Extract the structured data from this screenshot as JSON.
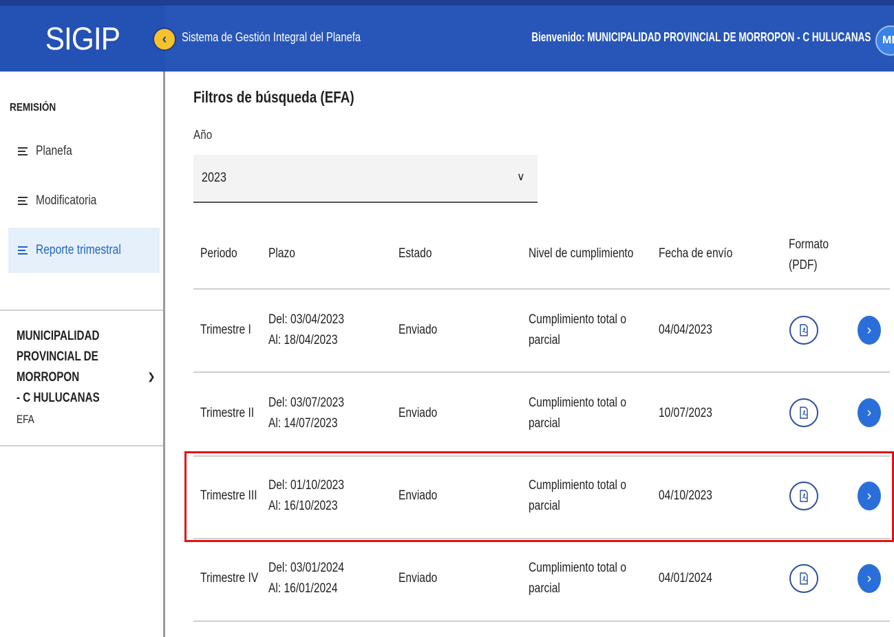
{
  "header": {
    "logo": "SIGIP",
    "app_name": "Sistema de Gestión Integral del Planefa",
    "welcome": "Bienvenido: MUNICIPALIDAD PROVINCIAL DE MORROPON - C HULUCANAS",
    "avatar_initials": "MP",
    "collapse_icon": "chevron-left-icon"
  },
  "sidebar": {
    "section_title": "REMISIÓN",
    "items": [
      {
        "label": "Planefa",
        "active": false
      },
      {
        "label": "Modificatoria",
        "active": false
      },
      {
        "label": "Reporte trimestral",
        "active": true
      }
    ],
    "entity": "MUNICIPALIDAD\nPROVINCIAL DE MORROPON\n- C HULUCANAS",
    "entity_type": "EFA"
  },
  "filters": {
    "title": "Filtros de búsqueda (EFA)",
    "year_label": "Año",
    "year_value": "2023"
  },
  "table": {
    "headers": {
      "periodo": "Periodo",
      "plazo": "Plazo",
      "estado": "Estado",
      "nivel": "Nivel de cumplimiento",
      "fecha": "Fecha de envío",
      "formato_1": "Formato",
      "formato_2": "(PDF)"
    },
    "rows": [
      {
        "periodo": "Trimestre I",
        "del": "Del: 03/04/2023",
        "al": "Al: 18/04/2023",
        "estado": "Enviado",
        "nivel_1": "Cumplimiento total o",
        "nivel_2": "parcial",
        "fecha": "04/04/2023"
      },
      {
        "periodo": "Trimestre II",
        "del": "Del: 03/07/2023",
        "al": "Al: 14/07/2023",
        "estado": "Enviado",
        "nivel_1": "Cumplimiento total o",
        "nivel_2": "parcial",
        "fecha": "10/07/2023"
      },
      {
        "periodo": "Trimestre III",
        "del": "Del: 01/10/2023",
        "al": "Al: 16/10/2023",
        "estado": "Enviado",
        "nivel_1": "Cumplimiento total o",
        "nivel_2": "parcial",
        "fecha": "04/10/2023"
      },
      {
        "periodo": "Trimestre IV",
        "del": "Del: 03/01/2024",
        "al": "Al: 16/01/2024",
        "estado": "Enviado",
        "nivel_1": "Cumplimiento total o",
        "nivel_2": "parcial",
        "fecha": "04/01/2024"
      }
    ]
  },
  "colors": {
    "header_blue": "#2856b8",
    "accent_yellow": "#f6c12a",
    "action_blue": "#2a6fd9",
    "highlight_red": "#e21212",
    "active_bg": "#e6f0fb"
  }
}
